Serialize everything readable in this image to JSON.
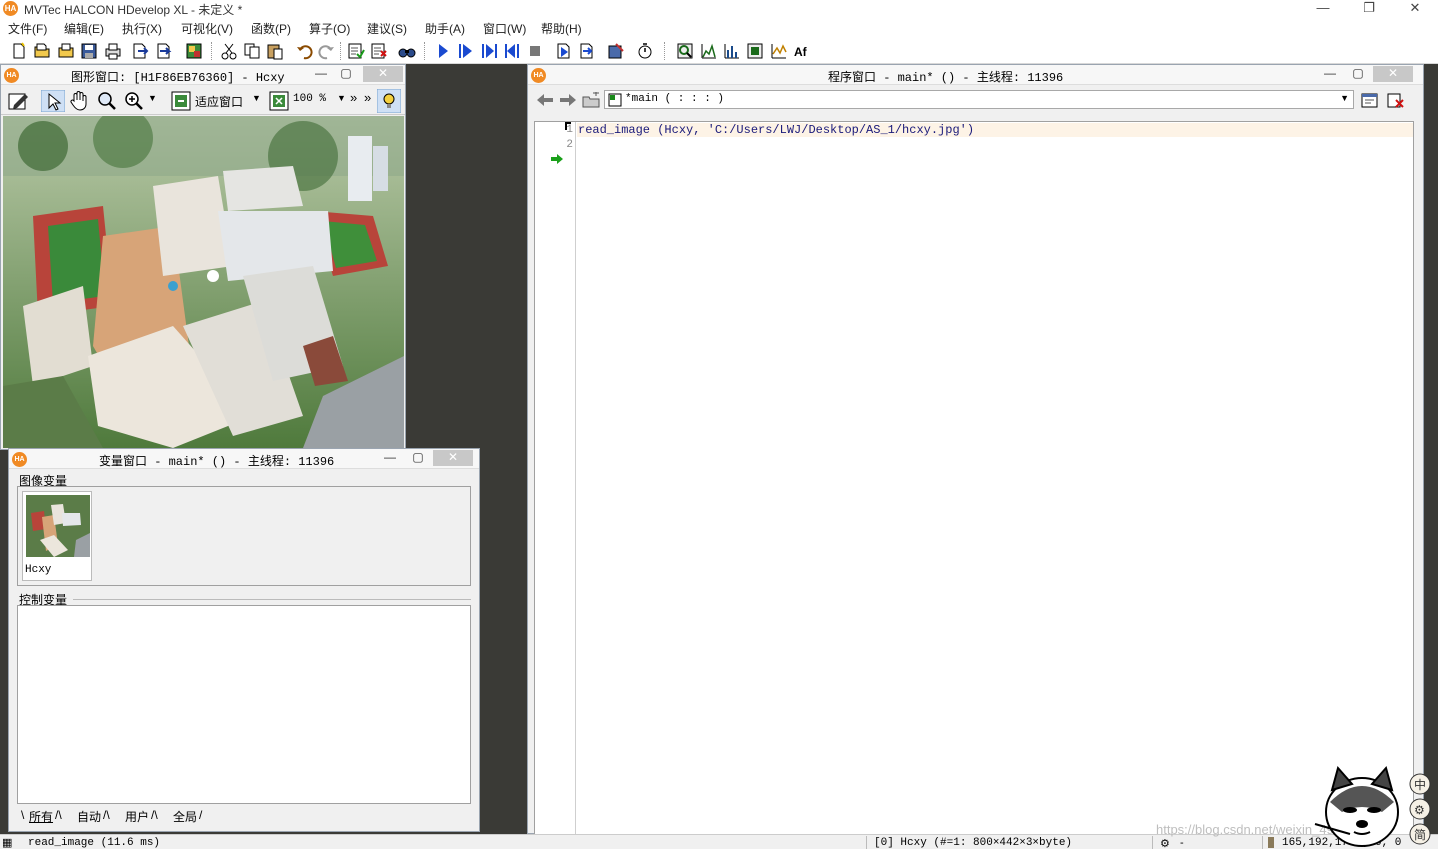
{
  "window": {
    "title": "MVTec HALCON HDevelop XL - 未定义 *",
    "app_icon": "HA"
  },
  "menu": [
    "文件(F)",
    "编辑(E)",
    "执行(X)",
    "可视化(V)",
    "函数(P)",
    "算子(O)",
    "建议(S)",
    "助手(A)",
    "窗口(W)",
    "帮助(H)"
  ],
  "graphics_window": {
    "title": "图形窗口: [H1F86EB76360] - Hcxy",
    "fit_label": "适应窗口",
    "zoom_label": "100 %"
  },
  "variable_window": {
    "title": "变量窗口 - main* () - 主线程: 11396",
    "image_vars_label": "图像变量",
    "image_var_name": "Hcxy",
    "control_vars_label": "控制变量",
    "tabs": [
      "所有",
      "自动",
      "用户",
      "全局"
    ]
  },
  "program_window": {
    "title": "程序窗口 - main* () - 主线程: 11396",
    "procedure_combo": "*main ( : : : )",
    "lines": [
      {
        "num": "1",
        "code": "read_image (Hcxy, 'C:/Users/LWJ/Desktop/AS_1/hcxy.jpg')"
      },
      {
        "num": "2",
        "code": ""
      }
    ]
  },
  "statusbar": {
    "message": "read_image (11.6 ms)",
    "image_info": "[0] Hcxy (#=1: 800×442×3×byte)",
    "mode": "-",
    "pixel_value": "165,192,173",
    "coords": "0, 0"
  },
  "watermark": "https://blog.csdn.net/weixin_4986xxxx",
  "mascot_badges": [
    "中",
    "⚙",
    "简"
  ]
}
